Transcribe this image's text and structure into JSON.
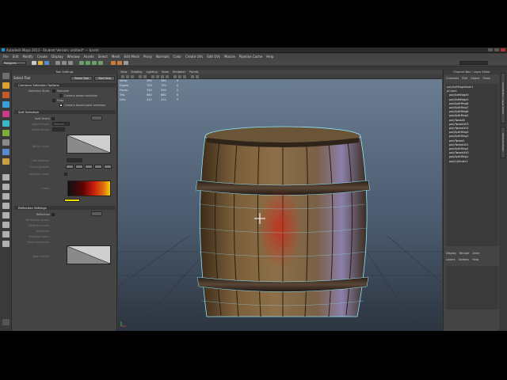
{
  "window": {
    "title": "Autodesk Maya 2013 - Student Version: untitled* --- barrel",
    "controls": [
      "minimize",
      "maximize",
      "close"
    ]
  },
  "menubar": [
    "File",
    "Edit",
    "Modify",
    "Create",
    "Display",
    "Window",
    "Assets",
    "Select",
    "Mesh",
    "Edit Mesh",
    "Proxy",
    "Normals",
    "Color",
    "Create UVs",
    "Edit UVs",
    "Muscle",
    "Pipeline Cache",
    "Help"
  ],
  "statusline": {
    "mode": "Polygons"
  },
  "tool_settings": {
    "header": "Tool Settings",
    "tool_name": "Select Tool",
    "reset_button": "Reset Tool",
    "help_button": "Tool Help",
    "common_section": "Common Selection Options",
    "selection_style_label": "Selection Style:",
    "selection_style_value": "Marquee",
    "camera_based": "Camera based selection",
    "drag_label": "Drag",
    "camera_paint": "Camera based paint selection",
    "soft_section": "Soft Selection",
    "soft_select_label": "Soft Select",
    "falloff_mode_label": "Falloff mode:",
    "falloff_mode_value": "Volume",
    "falloff_radius_label": "Falloff radius:",
    "falloff_curve_label": "Falloff curve:",
    "interpolation_label": "Interpolation:",
    "curve_presets_label": "Curve presets:",
    "viewport_color_label": "Viewport color:",
    "color_label": "Color:",
    "reflection_section": "Reflection Settings",
    "reflection_label": "Reflection",
    "reflection_space_label": "Reflection space:",
    "reflection_axis_label": "Reflection axis:",
    "tolerance_label": "Tolerance:",
    "preserve_label": "Preserve seam:",
    "seam_tolerance_label": "Seam tolerance:",
    "seam_falloff_label": "Seam falloff:",
    "colors": {
      "ramp_end": "#f5d000",
      "ramp_mid": "#c81a0a"
    }
  },
  "viewport": {
    "menus": [
      "View",
      "Shading",
      "Lighting",
      "Show",
      "Renderer",
      "Panels"
    ],
    "hud": [
      {
        "label": "Verts:",
        "a": "360",
        "b": "360",
        "c": "0"
      },
      {
        "label": "Edges:",
        "a": "700",
        "b": "700",
        "c": "0"
      },
      {
        "label": "Faces:",
        "a": "340",
        "b": "340",
        "c": "0"
      },
      {
        "label": "Tris:",
        "a": "680",
        "b": "680",
        "c": "0"
      },
      {
        "label": "UVs:",
        "a": "412",
        "b": "412",
        "c": "0"
      }
    ],
    "selection_color": "#c8281a",
    "wire_color": "#8ee8ff"
  },
  "outliner": {
    "header": "Channel Box / Layer Editor",
    "tabs": [
      "Channels",
      "Edit",
      "Object",
      "Show"
    ],
    "nodes": [
      "polySoftEdgeNode1",
      "pCube1",
      "polySoftEdge3",
      "polySoftEdge2",
      "polySplitRing8",
      "polySplitRing7",
      "polySplitRing6",
      "polySplitRing5",
      "polyTweak6",
      "polyTweakUV3",
      "polyTweakUV2",
      "polySplitRing4",
      "polySplitRing3",
      "polyTweak1",
      "polyTweakUV1",
      "polySplitRing2",
      "polyTweakUV0",
      "polySplitRing1",
      "polyCylinder1"
    ],
    "layer_tabs": [
      "Display",
      "Render",
      "Anim"
    ],
    "layer_menu": [
      "Layers",
      "Options",
      "Help"
    ]
  },
  "side_tabs": [
    "Channel Box / Layer Editor",
    "Attribute Editor"
  ]
}
